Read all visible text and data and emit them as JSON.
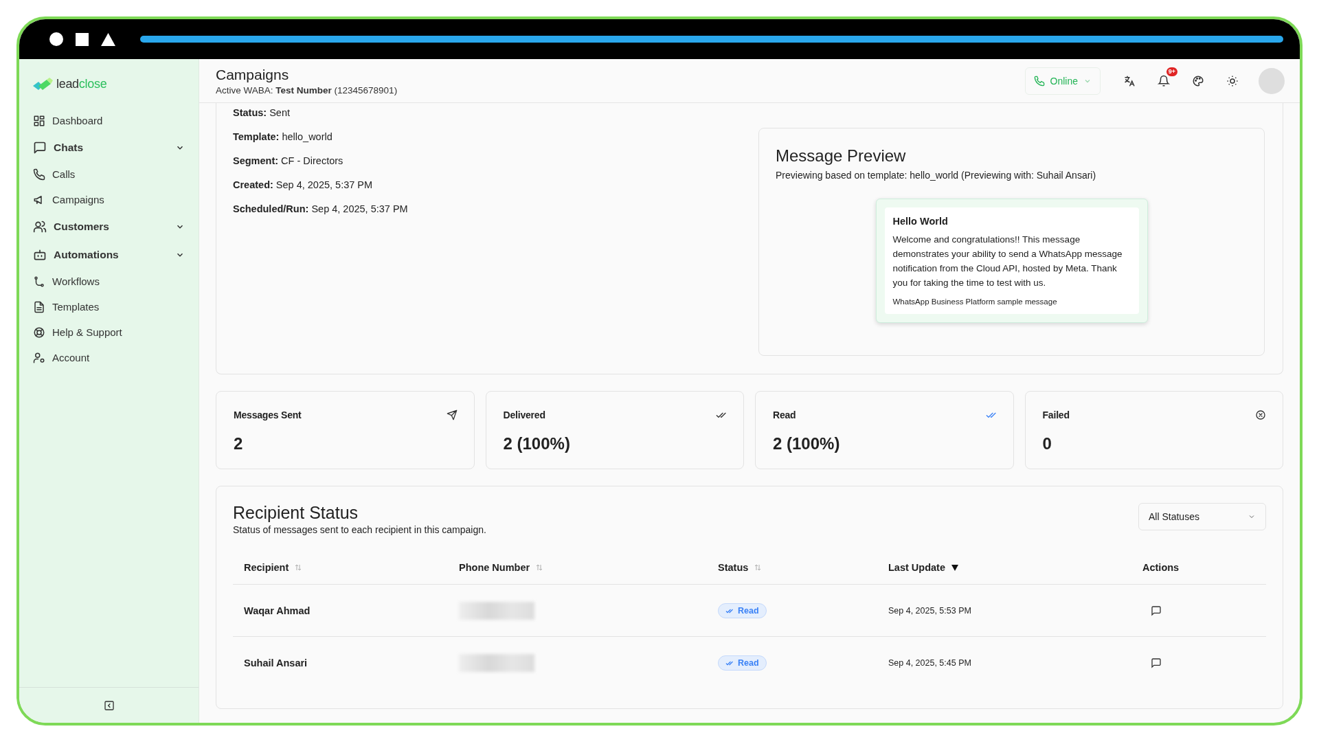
{
  "logo": {
    "parts": [
      "lead",
      "close"
    ]
  },
  "sidebar": {
    "items": [
      {
        "label": "Dashboard",
        "kind": "link"
      },
      {
        "label": "Chats",
        "kind": "group",
        "expanded": false
      },
      {
        "label": "Calls",
        "kind": "link"
      },
      {
        "label": "Campaigns",
        "kind": "link"
      },
      {
        "label": "Customers",
        "kind": "group",
        "expanded": false
      },
      {
        "label": "Automations",
        "kind": "group",
        "expanded": false
      },
      {
        "label": "Workflows",
        "kind": "link"
      },
      {
        "label": "Templates",
        "kind": "link"
      },
      {
        "label": "Help & Support",
        "kind": "link"
      },
      {
        "label": "Account",
        "kind": "link"
      }
    ]
  },
  "header": {
    "title": "Campaigns",
    "subtitle": "Active WABA: **Test Number** (12345678901)",
    "presence": "Online",
    "notification_count": "9+"
  },
  "details": [
    {
      "label": "Status:",
      "value": "Sent"
    },
    {
      "label": "Template:",
      "value": "hello_world"
    },
    {
      "label": "Segment:",
      "value": "CF - Directors"
    },
    {
      "label": "Created:",
      "value": "Sep 4, 2025, 5:37 PM"
    },
    {
      "label": "Scheduled/Run:",
      "value": "Sep 4, 2025, 5:37 PM"
    }
  ],
  "preview": {
    "title": "Message Preview",
    "subtitle": "Previewing based on template: hello_world (Previewing with: Suhail Ansari)",
    "message": {
      "title": "Hello World",
      "body": "Welcome and congratulations!! This message demonstrates your ability to send a WhatsApp message notification from the Cloud API, hosted by Meta. Thank you for taking the time to test with us.",
      "footer": "WhatsApp Business Platform sample message"
    }
  },
  "stats": [
    {
      "label": "Messages Sent",
      "value": "2"
    },
    {
      "label": "Delivered",
      "value": "2 (100%)"
    },
    {
      "label": "Read",
      "value": "2 (100%)"
    },
    {
      "label": "Failed",
      "value": "0"
    }
  ],
  "recipients": {
    "title": "Recipient Status",
    "subtitle": "Status of messages sent to each recipient in this campaign.",
    "filter": {
      "value": "All Statuses"
    },
    "columns": [
      {
        "label": "Recipient",
        "sorted": false
      },
      {
        "label": "Phone Number",
        "sorted": false
      },
      {
        "label": "Status",
        "sorted": false
      },
      {
        "label": "Last Update",
        "sorted": true
      },
      {
        "label": "Actions"
      }
    ],
    "rows": [
      {
        "recipient": "Waqar Ahmad",
        "status": "Read",
        "last_update": "Sep 4, 2025, 5:53 PM"
      },
      {
        "recipient": "Suhail Ansari",
        "status": "Read",
        "last_update": "Sep 4, 2025, 5:45 PM"
      }
    ]
  }
}
